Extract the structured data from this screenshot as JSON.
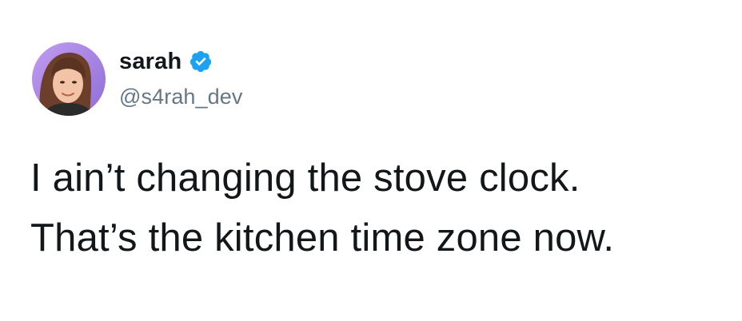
{
  "author": {
    "display_name": "sarah",
    "handle": "@s4rah_dev",
    "verified": true,
    "avatar_icon": "profile-photo",
    "verified_icon": "verified-badge-icon"
  },
  "tweet": {
    "lines": [
      "I ain’t changing the stove clock.",
      "That’s the kitchen time zone now."
    ]
  },
  "colors": {
    "text_primary": "#14171a",
    "text_secondary": "#657786",
    "verified_blue": "#1da1f2",
    "avatar_bg": "#a98be6"
  }
}
